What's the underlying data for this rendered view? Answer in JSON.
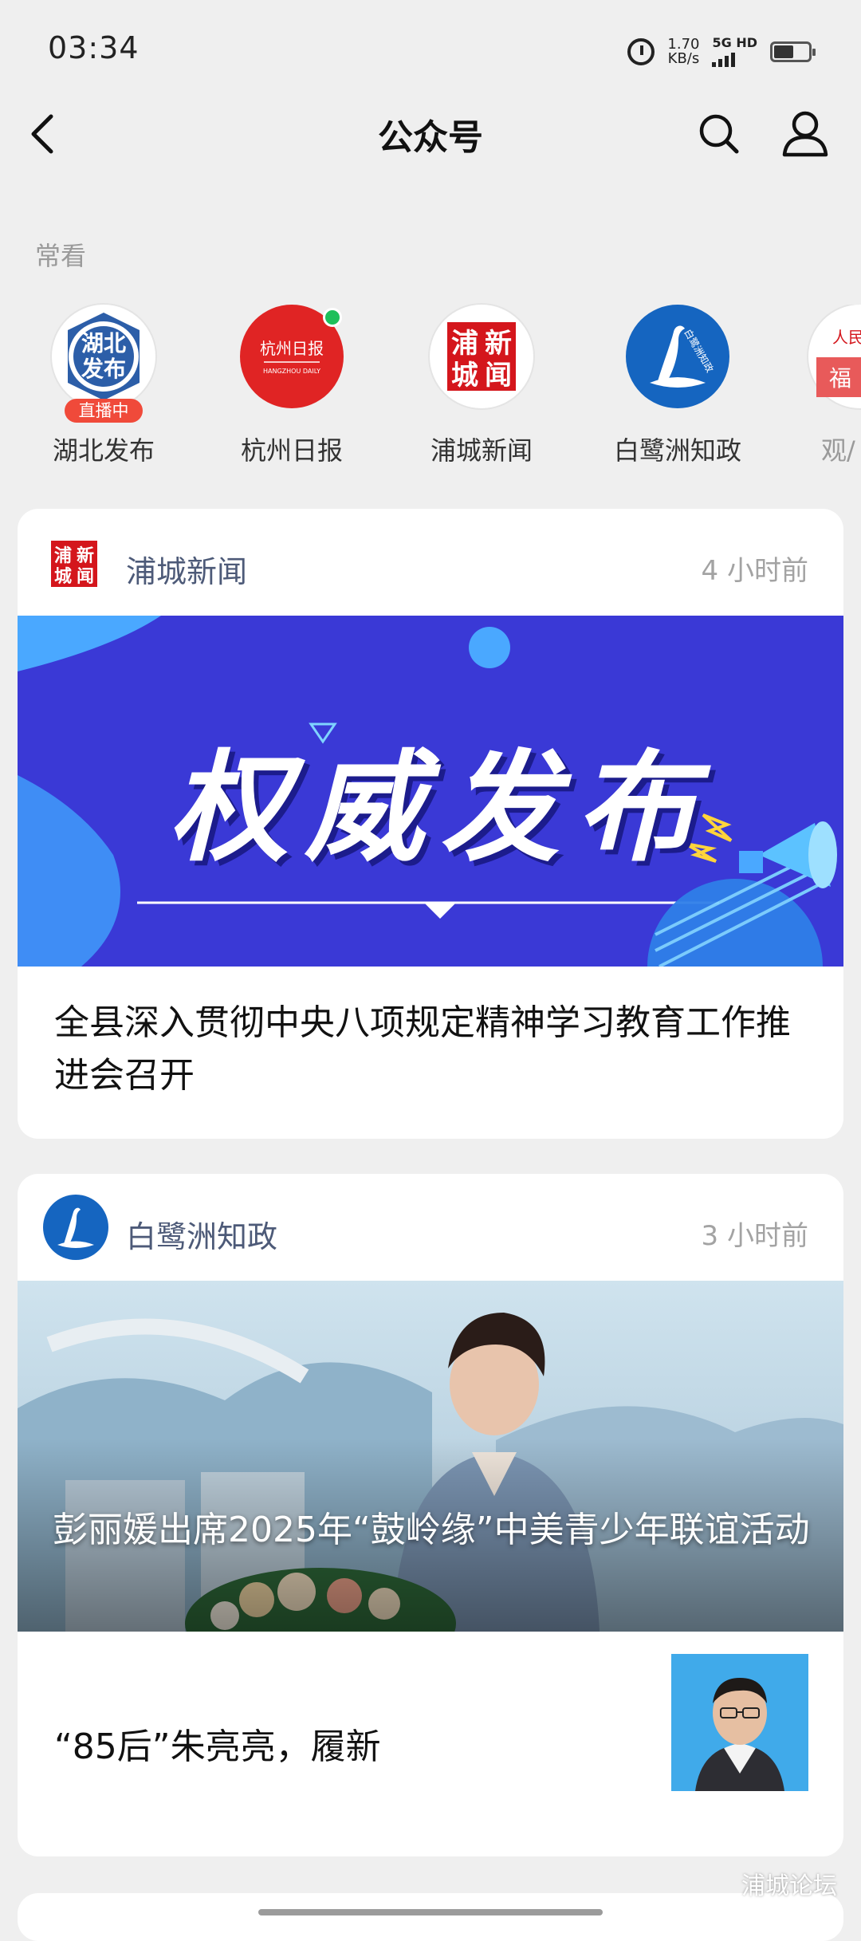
{
  "status_bar": {
    "time": "03:34",
    "speed_value": "1.70",
    "speed_unit": "KB/s",
    "network": "5G HD"
  },
  "header": {
    "title": "公众号"
  },
  "frequent": {
    "label": "常看",
    "accounts": [
      {
        "name": "湖北发布",
        "badge": "直播中",
        "logo_text": "湖北发布"
      },
      {
        "name": "杭州日报",
        "logo_text": "杭州日报",
        "logo_sub": "HANGZHOU DAILY"
      },
      {
        "name": "浦城新闻",
        "logo_text": "浦城新闻"
      },
      {
        "name": "白鹭洲知政",
        "logo_text": "白鹭洲知政"
      },
      {
        "name": "观/",
        "logo_text": "人民日报",
        "logo_sub": "福"
      }
    ]
  },
  "feed": [
    {
      "source": "浦城新闻",
      "time": "4 小时前",
      "banner_text": "权威发布",
      "headline": "全县深入贯彻中央八项规定精神学习教育工作推进会召开"
    },
    {
      "source": "白鹭洲知政",
      "time": "3 小时前",
      "image_caption": "彭丽媛出席2025年“鼓岭缘”中美青少年联谊活动",
      "sub_headline": "“85后”朱亮亮，履新"
    }
  ],
  "watermark": "浦城论坛",
  "colors": {
    "background": "#efefef",
    "source_name": "#4d5a78",
    "banner_blue": "#3a39d6",
    "live_red": "#f04a3a"
  }
}
